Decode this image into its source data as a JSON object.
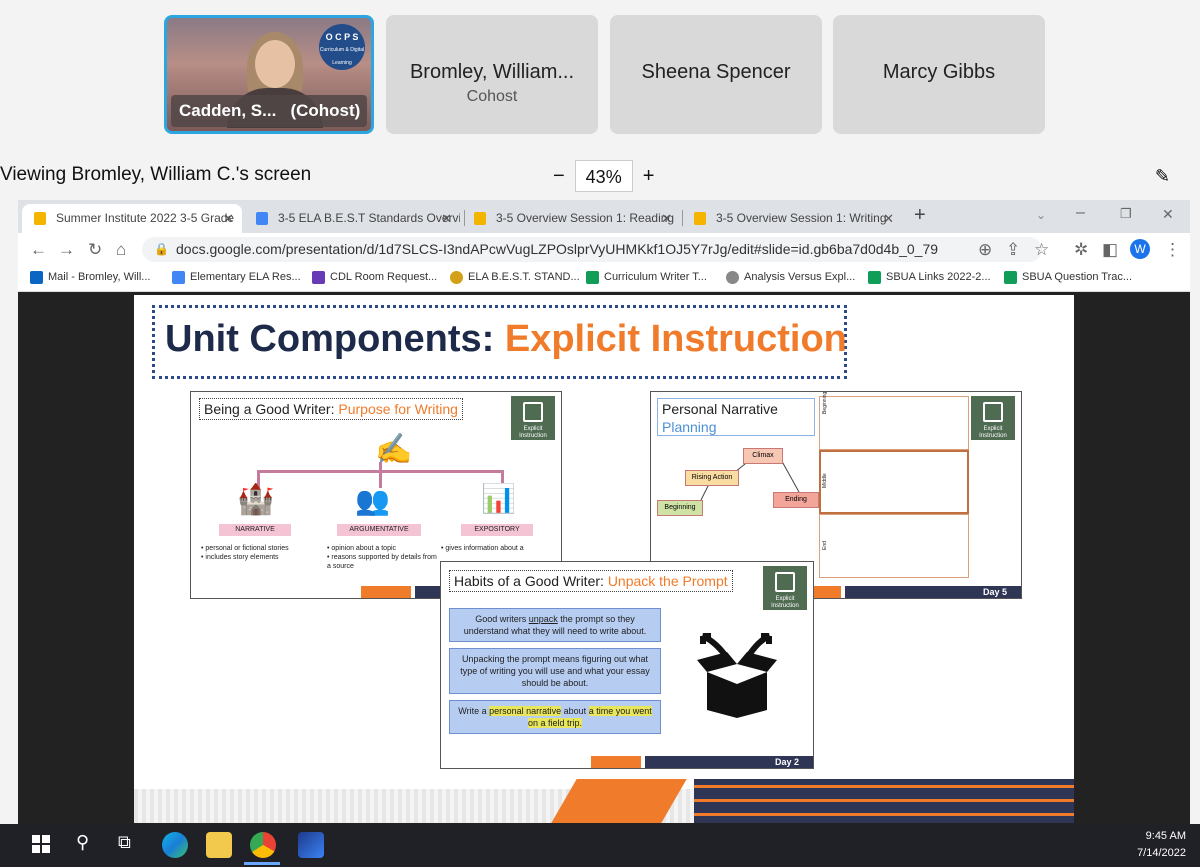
{
  "participants": [
    {
      "label": "Cadden, S...",
      "role": "(Cohost)",
      "logo": "O C P S",
      "logo_sub": "Curriculum & Digital Learning"
    },
    {
      "label": "Bromley, William...",
      "role": "Cohost"
    },
    {
      "label": "Sheena Spencer"
    },
    {
      "label": "Marcy Gibbs"
    }
  ],
  "viewing": {
    "text": "Viewing Bromley, William C.'s screen",
    "zoom": "43%",
    "minus": "−",
    "plus": "+"
  },
  "browser": {
    "tabs": [
      {
        "title": "Summer Institute 2022 3-5 Grade",
        "icon_color": "#f4b400"
      },
      {
        "title": "3-5 ELA B.E.S.T Standards Overvi",
        "icon_color": "#4285f4"
      },
      {
        "title": "3-5 Overview Session 1: Reading",
        "icon_color": "#f4b400"
      },
      {
        "title": "3-5 Overview Session 1: Writing",
        "icon_color": "#f4b400"
      }
    ],
    "url": "docs.google.com/presentation/d/1d7SLCS-I3ndAPcwVugLZPOslprVyUHMKkf1OJ5Y7rJg/edit#slide=id.gb6ba7d0d4b_0_79",
    "profile_initial": "W",
    "bookmarks": [
      {
        "label": "Mail - Bromley, Will...",
        "color": "#0a66c2"
      },
      {
        "label": "Elementary ELA Res...",
        "color": "#4285f4"
      },
      {
        "label": "CDL Room Request...",
        "color": "#673ab7"
      },
      {
        "label": "ELA B.E.S.T. STAND...",
        "color": "#d4a017"
      },
      {
        "label": "Curriculum Writer T...",
        "color": "#0f9d58"
      },
      {
        "label": "Analysis Versus Expl...",
        "color": "#888888"
      },
      {
        "label": "SBUA Links 2022-2...",
        "color": "#0f9d58"
      },
      {
        "label": "SBUA Question Trac...",
        "color": "#0f9d58"
      }
    ]
  },
  "slide": {
    "title_main": "Unit Components: ",
    "title_accent": "Explicit Instruction",
    "badge_text": "Explicit Instruction",
    "card1": {
      "title_main": "Being a Good Writer: ",
      "title_accent": "Purpose for Writing",
      "types": [
        {
          "label": "NARRATIVE",
          "bullets": [
            "personal or fictional stories",
            "includes story elements"
          ]
        },
        {
          "label": "ARGUMENTATIVE",
          "bullets": [
            "opinion about a topic",
            "reasons supported by details from a source"
          ]
        },
        {
          "label": "EXPOSITORY",
          "bullets": [
            "gives information about a"
          ]
        }
      ]
    },
    "card2": {
      "title_line1": "Personal Narrative",
      "title_line2": "Planning",
      "nodes": [
        "Climax",
        "Rising Action",
        "Beginning",
        "Ending"
      ],
      "side_labels": [
        "Beginning",
        "Middle",
        "End"
      ],
      "day": "Day 5"
    },
    "card3": {
      "title_main": "Habits of a Good Writer: ",
      "title_accent": "Unpack the Prompt",
      "box1_pre": "Good writers ",
      "box1_u": "unpack",
      "box1_post": " the prompt so they understand what they will need to write about.",
      "box2": "Unpacking the prompt means figuring out what type of writing you will use and what your essay should be about.",
      "box3_a": "Write a ",
      "box3_b": "personal narrative",
      "box3_c": " about ",
      "box3_d": "a time you went on a field trip.",
      "day": "Day 2"
    }
  },
  "taskbar": {
    "time": "9:45 AM",
    "date": "7/14/2022"
  },
  "colors": {
    "accent_orange": "#f07b2a",
    "navy": "#1e2a4a",
    "active_border": "#2ba6e0"
  }
}
